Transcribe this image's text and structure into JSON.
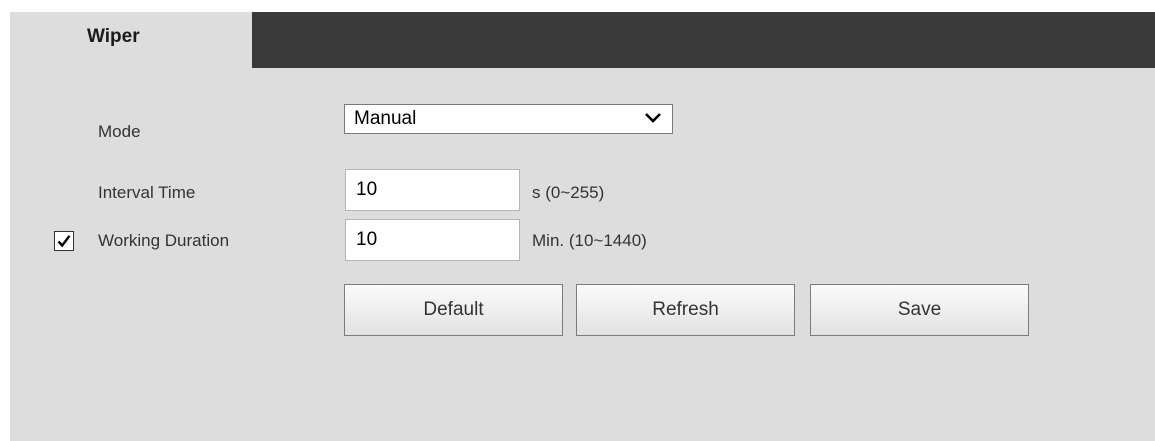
{
  "tab": {
    "label": "Wiper"
  },
  "form": {
    "mode": {
      "label": "Mode",
      "value": "Manual"
    },
    "interval_time": {
      "label": "Interval Time",
      "value": "10",
      "hint": "s (0~255)"
    },
    "working_duration": {
      "label": "Working Duration",
      "checked": true,
      "value": "10",
      "hint": "Min. (10~1440)"
    }
  },
  "buttons": {
    "default_label": "Default",
    "refresh_label": "Refresh",
    "save_label": "Save"
  },
  "icons": {
    "dropdown": "chevron-down-icon",
    "checkmark": "checkmark-icon"
  },
  "colors": {
    "panel_background": "#dddddd",
    "tab_bar": "#3a3a3a"
  }
}
